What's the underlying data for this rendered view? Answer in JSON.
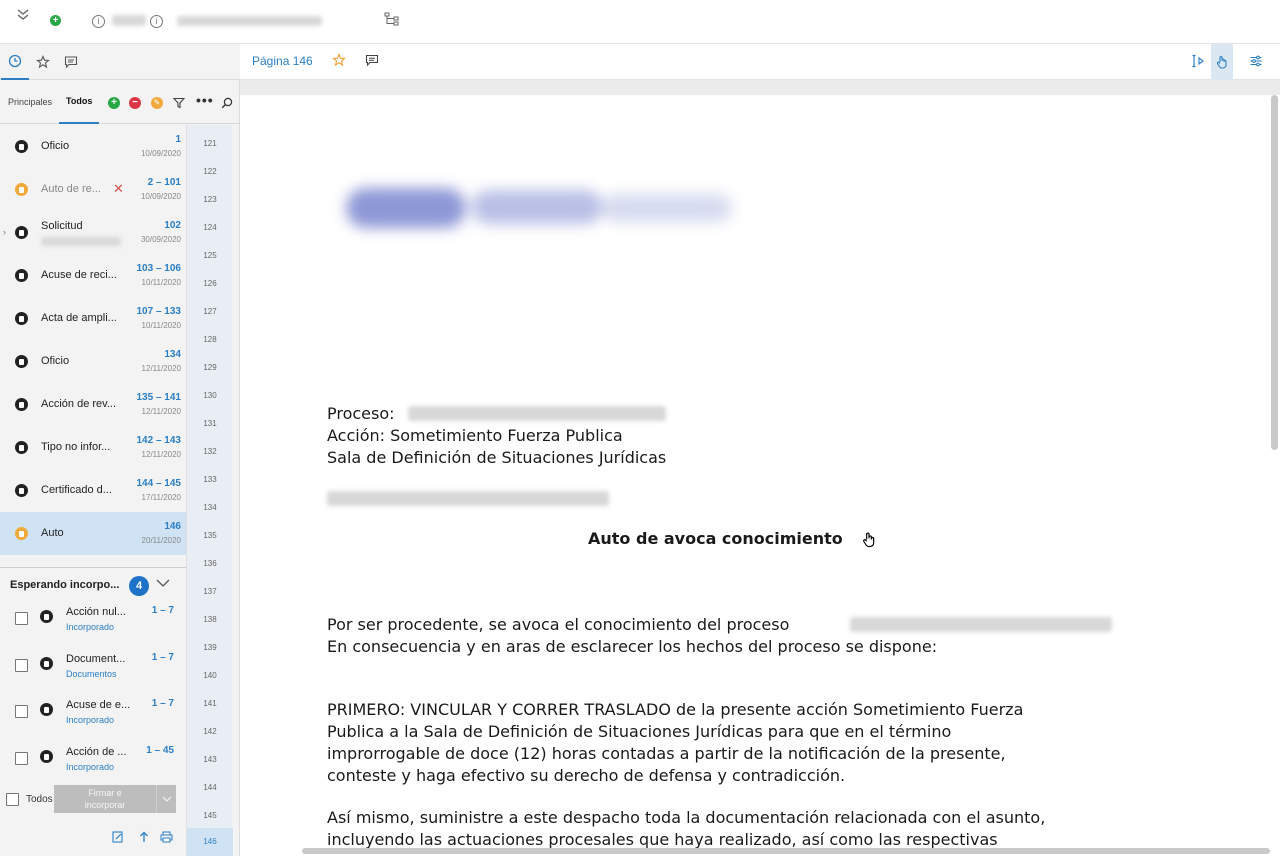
{
  "viewer": {
    "page_label": "Página 146"
  },
  "sidebar": {
    "subtabs": [
      "Principales",
      "Todos"
    ],
    "documents": [
      {
        "title": "Oficio",
        "range": "1",
        "date": "10/09/2020",
        "icon": "user-icon",
        "dim": false
      },
      {
        "title": "Auto de re...",
        "range": "2 – 101",
        "date": "10/09/2020",
        "icon": "auto-icon",
        "dim": true
      },
      {
        "title": "Solicitud",
        "range": "102",
        "date": "30/09/2020",
        "icon": "request-icon",
        "dim": false
      },
      {
        "title": "Acuse de reci...",
        "range": "103 – 106",
        "date": "10/11/2020",
        "icon": "document-icon",
        "dim": false
      },
      {
        "title": "Acta de ampli...",
        "range": "107 – 133",
        "date": "10/11/2020",
        "icon": "document-icon",
        "dim": false
      },
      {
        "title": "Oficio",
        "range": "134",
        "date": "12/11/2020",
        "icon": "user-icon",
        "dim": false
      },
      {
        "title": "Acción de rev...",
        "range": "135 – 141",
        "date": "12/11/2020",
        "icon": "document-icon",
        "dim": false
      },
      {
        "title": "Tipo no infor...",
        "range": "142 – 143",
        "date": "12/11/2020",
        "icon": "document-icon",
        "dim": false
      },
      {
        "title": "Certificado d...",
        "range": "144 – 145",
        "date": "17/11/2020",
        "icon": "document-icon",
        "dim": false
      },
      {
        "title": "Auto",
        "range": "146",
        "date": "20/11/2020",
        "icon": "auto-icon",
        "dim": false
      }
    ],
    "page_numbers": [
      "121",
      "122",
      "123",
      "124",
      "125",
      "126",
      "127",
      "128",
      "129",
      "130",
      "131",
      "132",
      "133",
      "134",
      "135",
      "136",
      "137",
      "138",
      "139",
      "140",
      "141",
      "142",
      "143",
      "144",
      "145",
      "146"
    ],
    "waiting": {
      "title": "Esperando incorpo...",
      "count": "4",
      "items": [
        {
          "title": "Acción nul...",
          "status": "Incorporado",
          "range": "1 – 7"
        },
        {
          "title": "Document...",
          "status": "Documentos",
          "range": "1 – 7"
        },
        {
          "title": "Acuse de e...",
          "status": "Incorporado",
          "range": "1 – 7"
        },
        {
          "title": "Acción de ...",
          "status": "Incorporado",
          "range": "1 – 45"
        }
      ]
    },
    "select_all_label": "Todos",
    "sign_button_line1": "Firmar e",
    "sign_button_line2": "incorporar"
  },
  "document": {
    "line_proceso": "Proceso:",
    "line_accion": "Acción: Sometimiento Fuerza Publica",
    "line_sala": "Sala de Definición de Situaciones Jurídicas",
    "heading": "Auto de avoca conocimiento",
    "para1_l1": "Por ser procedente, se avoca el conocimiento del proceso",
    "para1_l2": "En consecuencia y en aras de esclarecer los hechos del proceso se dispone:",
    "para2_l1": "PRIMERO: VINCULAR Y CORRER TRASLADO de la presente acción Sometimiento Fuerza",
    "para2_l2": "Publica a la Sala de Definición de Situaciones Jurídicas para que en el término",
    "para2_l3": "improrrogable de doce (12) horas contadas a partir de la notificación de la presente,",
    "para2_l4": "conteste y haga efectivo su derecho de defensa y contradicción.",
    "para3_l1": "Así mismo, suministre a este despacho toda la documentación relacionada con el asunto,",
    "para3_l2": "incluyendo las actuaciones procesales que haya realizado, así como las respectivas"
  }
}
